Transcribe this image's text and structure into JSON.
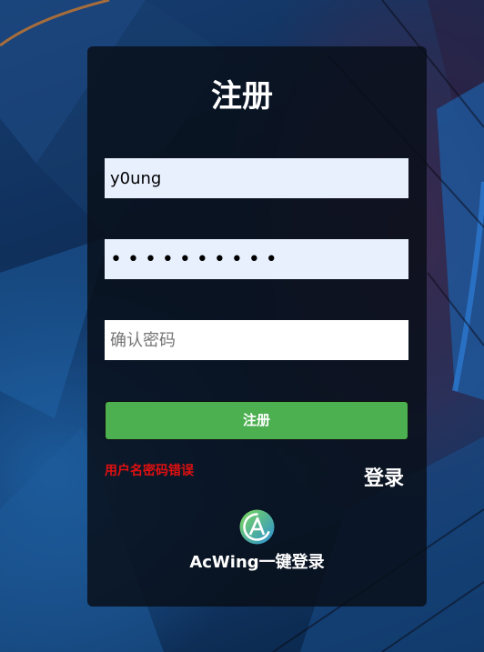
{
  "form": {
    "title": "注册",
    "username_value": "y0ung",
    "password_value": "••••••••••",
    "confirm_placeholder": "确认密码",
    "submit_label": "注册",
    "error_message": "用户名密码错误",
    "login_link": "登录",
    "third_party": {
      "icon": "acwing-logo-icon",
      "label": "AcWing一键登录"
    }
  },
  "colors": {
    "submit_button": "#4caf50",
    "error_text": "#e01010",
    "autofill_field": "#e8f0fe",
    "card_background": "#080e18"
  }
}
